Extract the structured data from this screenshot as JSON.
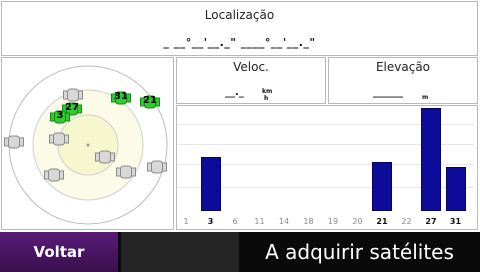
{
  "location": {
    "title": "Localização",
    "coords": "_ __°__'__._\" ____°__'__._\""
  },
  "speed": {
    "title": "Veloc.",
    "value": "__._",
    "unit_top": "km",
    "unit_bottom": "h"
  },
  "elevation": {
    "title": "Elevação",
    "value": "______",
    "unit": "m"
  },
  "sky_view": {
    "satellites": [
      {
        "id": "27",
        "state": "locked"
      },
      {
        "id": "31",
        "state": "locked"
      },
      {
        "id": "21",
        "state": "locked"
      },
      {
        "id": "3",
        "state": "locked"
      },
      {
        "id": "",
        "state": "searching"
      },
      {
        "id": "",
        "state": "searching"
      },
      {
        "id": "",
        "state": "searching"
      },
      {
        "id": "",
        "state": "searching"
      },
      {
        "id": "",
        "state": "searching"
      },
      {
        "id": "",
        "state": "searching"
      },
      {
        "id": "",
        "state": "searching"
      }
    ]
  },
  "chart_data": {
    "type": "bar",
    "categories": [
      "1",
      "3",
      "6",
      "11",
      "14",
      "18",
      "19",
      "20",
      "21",
      "22",
      "27",
      "31"
    ],
    "values": [
      0,
      52,
      0,
      0,
      0,
      0,
      0,
      0,
      48,
      0,
      100,
      43
    ],
    "highlighted": [
      "3",
      "21",
      "27",
      "31"
    ],
    "ylim": [
      0,
      100
    ],
    "bar_color": "#0d0b9a"
  },
  "buttons": {
    "back": "Voltar"
  },
  "status": {
    "text": "A adquirir satélites"
  },
  "colors": {
    "accent": "#4a1566",
    "locked": "#2ecc2e"
  }
}
